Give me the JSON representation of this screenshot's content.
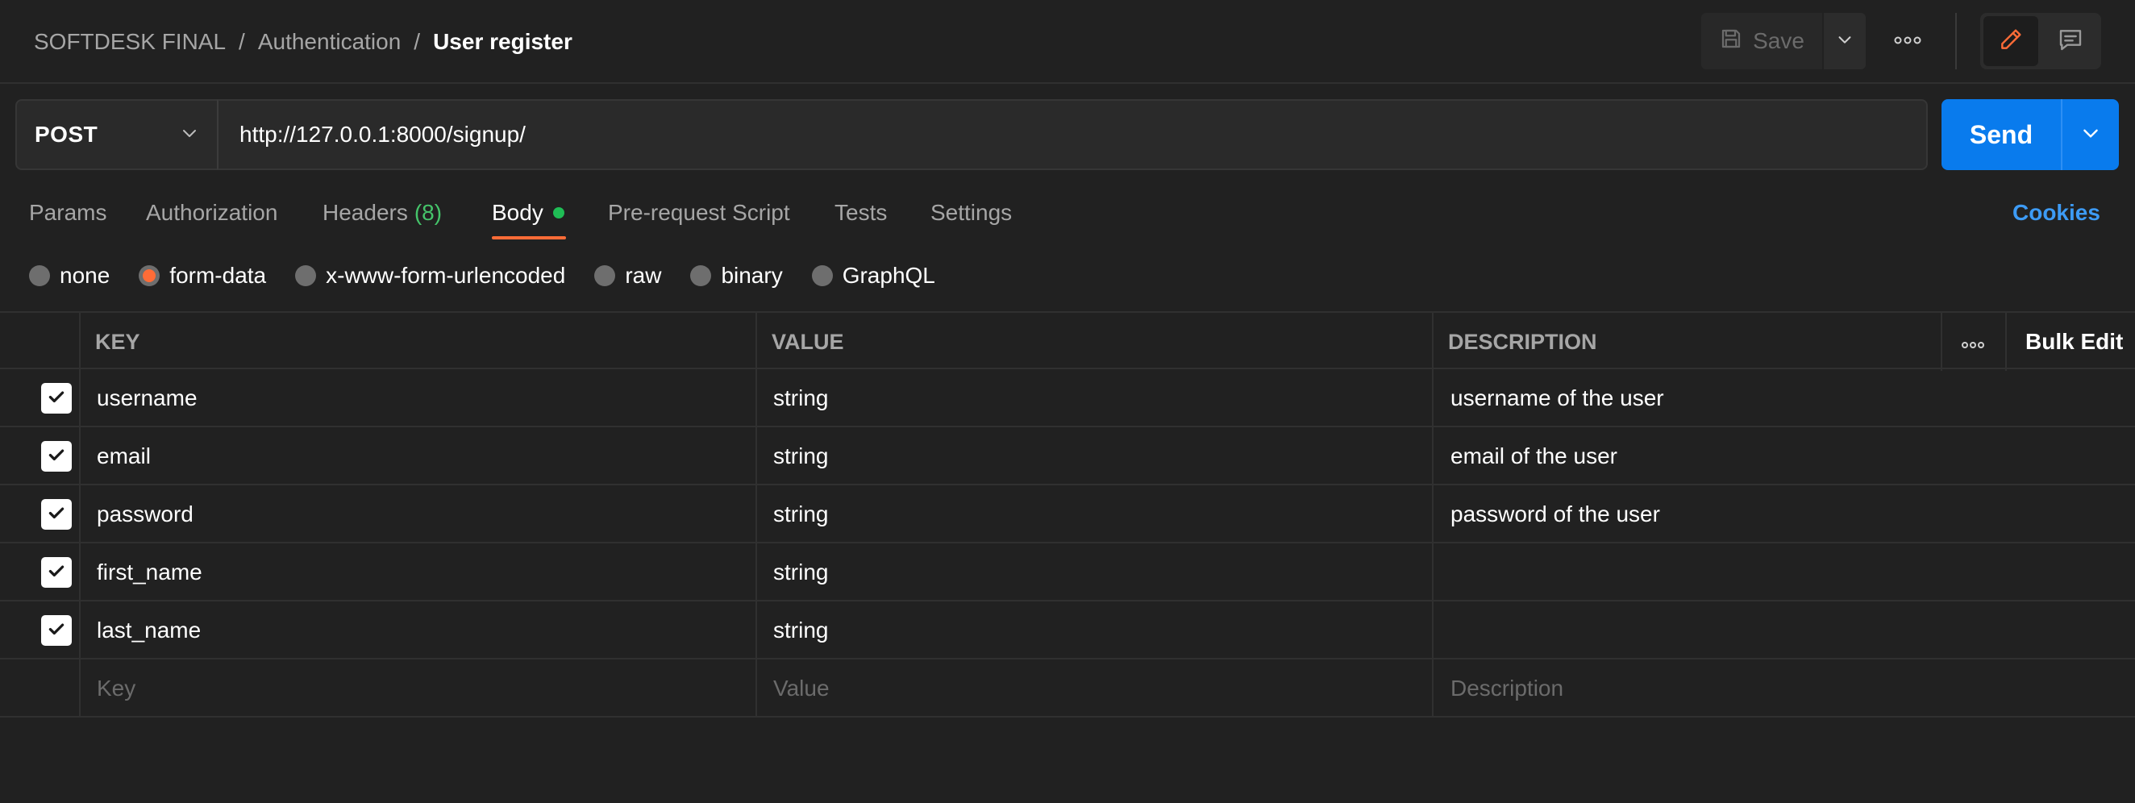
{
  "breadcrumb": {
    "collection": "SOFTDESK FINAL",
    "folder": "Authentication",
    "request": "User register",
    "separator": "/"
  },
  "toolbar": {
    "save_label": "Save",
    "save_icon": "save-icon",
    "more_icon": "more-horizontal-icon",
    "edit_icon": "pencil-icon",
    "comments_icon": "comment-icon"
  },
  "request": {
    "method": "POST",
    "url": "http://127.0.0.1:8000/signup/",
    "send_label": "Send"
  },
  "tabs": [
    {
      "label": "Params",
      "active": false
    },
    {
      "label": "Authorization",
      "active": false
    },
    {
      "label": "Headers",
      "count": "(8)",
      "active": false
    },
    {
      "label": "Body",
      "active": true
    },
    {
      "label": "Pre-request Script",
      "active": false
    },
    {
      "label": "Tests",
      "active": false
    },
    {
      "label": "Settings",
      "active": false
    }
  ],
  "cookies_label": "Cookies",
  "body_types": [
    {
      "label": "none",
      "selected": false
    },
    {
      "label": "form-data",
      "selected": true
    },
    {
      "label": "x-www-form-urlencoded",
      "selected": false
    },
    {
      "label": "raw",
      "selected": false
    },
    {
      "label": "binary",
      "selected": false
    },
    {
      "label": "GraphQL",
      "selected": false
    }
  ],
  "table": {
    "headers": {
      "key": "KEY",
      "value": "VALUE",
      "description": "DESCRIPTION",
      "bulk_edit": "Bulk Edit"
    },
    "rows": [
      {
        "checked": true,
        "key": "username",
        "value": "string",
        "description": "username of the user"
      },
      {
        "checked": true,
        "key": "email",
        "value": "string",
        "description": "email of the user"
      },
      {
        "checked": true,
        "key": "password",
        "value": "string",
        "description": "password of the user"
      },
      {
        "checked": true,
        "key": "first_name",
        "value": "string",
        "description": ""
      },
      {
        "checked": true,
        "key": "last_name",
        "value": "string",
        "description": ""
      }
    ],
    "placeholders": {
      "key": "Key",
      "value": "Value",
      "description": "Description"
    }
  },
  "colors": {
    "background": "#212121",
    "accent_orange": "#ff6c37",
    "send_blue": "#097bed",
    "cookies_blue": "#3d9bf5",
    "body_dot_green": "#1fbd55",
    "headers_count_green": "#45c46a"
  }
}
